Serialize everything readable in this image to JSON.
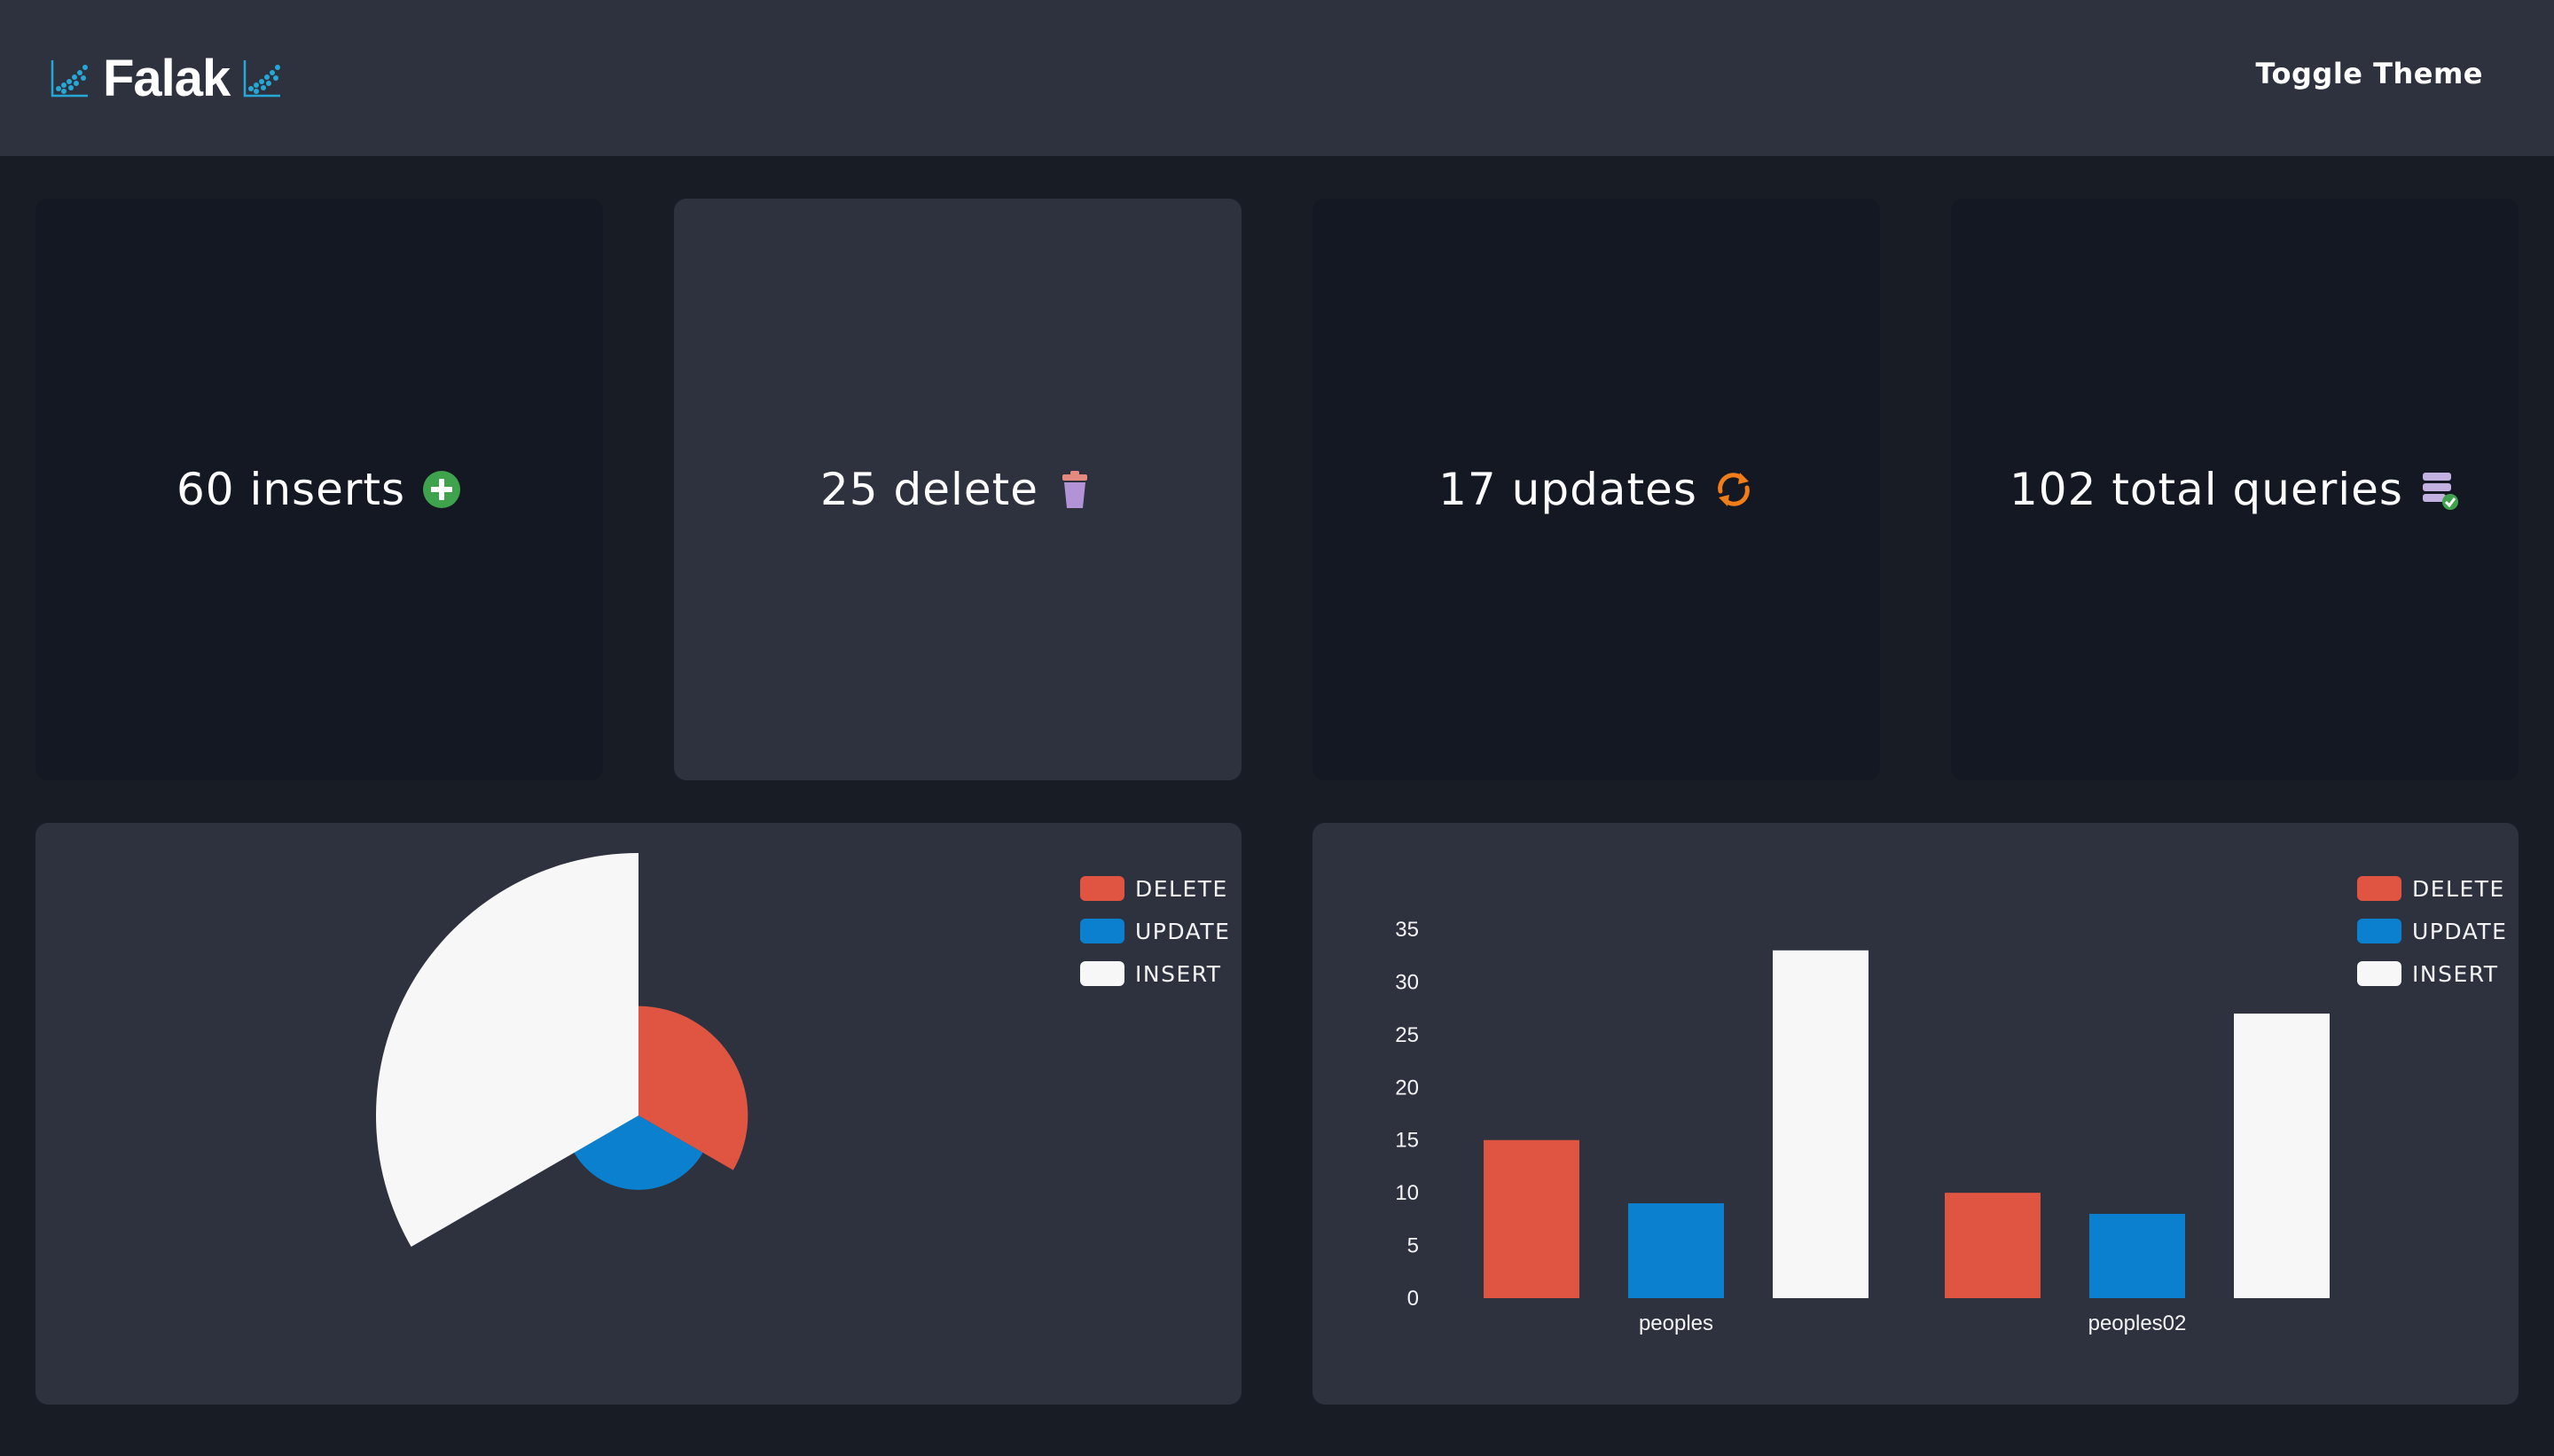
{
  "header": {
    "app_name": "Falak",
    "toggle_label": "Toggle Theme"
  },
  "stats": [
    {
      "label": "60 inserts",
      "icon": "plus-circle-icon",
      "color": "#3fa34d"
    },
    {
      "label": "25 delete",
      "icon": "trash-icon",
      "color": "#b294d6"
    },
    {
      "label": "17 updates",
      "icon": "refresh-icon",
      "color": "#f07d1a"
    },
    {
      "label": "102 total queries",
      "icon": "database-check-icon",
      "color": "#c3b1e1"
    }
  ],
  "legend": [
    {
      "label": "DELETE",
      "color": "#e05442"
    },
    {
      "label": "UPDATE",
      "color": "#0a80cf"
    },
    {
      "label": "INSERT",
      "color": "#f7f7f7"
    }
  ],
  "chart_data": [
    {
      "type": "pie",
      "variant": "polar-area",
      "series": [
        {
          "name": "DELETE",
          "value": 25,
          "color": "#e05442"
        },
        {
          "name": "UPDATE",
          "value": 17,
          "color": "#0a80cf"
        },
        {
          "name": "INSERT",
          "value": 60,
          "color": "#f7f7f7"
        }
      ],
      "legend_position": "top-right"
    },
    {
      "type": "bar",
      "categories": [
        "peoples",
        "peoples02"
      ],
      "series": [
        {
          "name": "DELETE",
          "values": [
            15,
            10
          ],
          "color": "#e05442"
        },
        {
          "name": "UPDATE",
          "values": [
            9,
            8
          ],
          "color": "#0a80cf"
        },
        {
          "name": "INSERT",
          "values": [
            33,
            27
          ],
          "color": "#f7f7f7"
        }
      ],
      "ylim": [
        0,
        35
      ],
      "yticks": [
        0,
        5,
        10,
        15,
        20,
        25,
        30,
        35
      ],
      "grid": false,
      "legend_position": "top-right"
    }
  ]
}
